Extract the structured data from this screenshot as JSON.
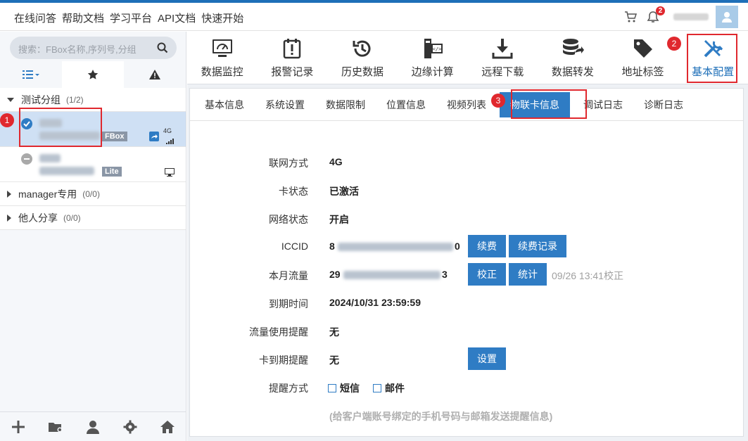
{
  "topnav": [
    "在线问答",
    "帮助文档",
    "学习平台",
    "API文档",
    "快速开始"
  ],
  "notifications": {
    "count": "2"
  },
  "sidebar": {
    "search_placeholder": "搜索：FBox名称,序列号,分组",
    "groups": [
      {
        "name": "测试分组",
        "count": "(1/2)",
        "expanded": true
      },
      {
        "name": "manager专用",
        "count": "(0/0)",
        "expanded": false
      },
      {
        "name": "他人分享",
        "count": "(0/0)",
        "expanded": false
      }
    ],
    "devices": [
      {
        "tag": "FBox",
        "signal": "4G",
        "status": "online",
        "selected": true
      },
      {
        "tag": "Lite",
        "status": "offline",
        "selected": false
      }
    ]
  },
  "toolbar": [
    {
      "label": "数据监控",
      "icon": "monitor-icon"
    },
    {
      "label": "报警记录",
      "icon": "alarm-icon"
    },
    {
      "label": "历史数据",
      "icon": "history-icon"
    },
    {
      "label": "边缘计算",
      "icon": "edge-compute-icon"
    },
    {
      "label": "远程下载",
      "icon": "download-icon"
    },
    {
      "label": "数据转发",
      "icon": "database-forward-icon"
    },
    {
      "label": "地址标签",
      "icon": "tag-icon"
    },
    {
      "label": "基本配置",
      "icon": "tools-icon",
      "active": true
    }
  ],
  "subtabs": [
    "基本信息",
    "系统设置",
    "数据限制",
    "位置信息",
    "视频列表",
    "物联卡信息",
    "调试日志",
    "诊断日志"
  ],
  "active_subtab": "物联卡信息",
  "annotations": [
    "1",
    "2",
    "3"
  ],
  "card": {
    "network_label": "联网方式",
    "network_value": "4G",
    "card_status_label": "卡状态",
    "card_status_value": "已激活",
    "net_status_label": "网络状态",
    "net_status_value": "开启",
    "iccid_label": "ICCID",
    "iccid_prefix": "8",
    "iccid_suffix": "0",
    "renew_button": "续费",
    "renew_record_button": "续费记录",
    "traffic_label": "本月流量",
    "traffic_prefix": "29",
    "traffic_suffix": "3",
    "calibrate_button": "校正",
    "stats_button": "统计",
    "calibrate_note": "09/26 13:41校正",
    "expire_label": "到期时间",
    "expire_value": "2024/10/31 23:59:59",
    "traffic_alert_label": "流量使用提醒",
    "traffic_alert_value": "无",
    "expire_alert_label": "卡到期提醒",
    "expire_alert_value": "无",
    "settings_button": "设置",
    "remind_method_label": "提醒方式",
    "sms_label": "短信",
    "email_label": "邮件",
    "hint": "(给客户端账号绑定的手机号码与邮箱发送提醒信息)"
  },
  "colors": {
    "accent": "#2f7cc4",
    "highlight": "#e0282e"
  }
}
